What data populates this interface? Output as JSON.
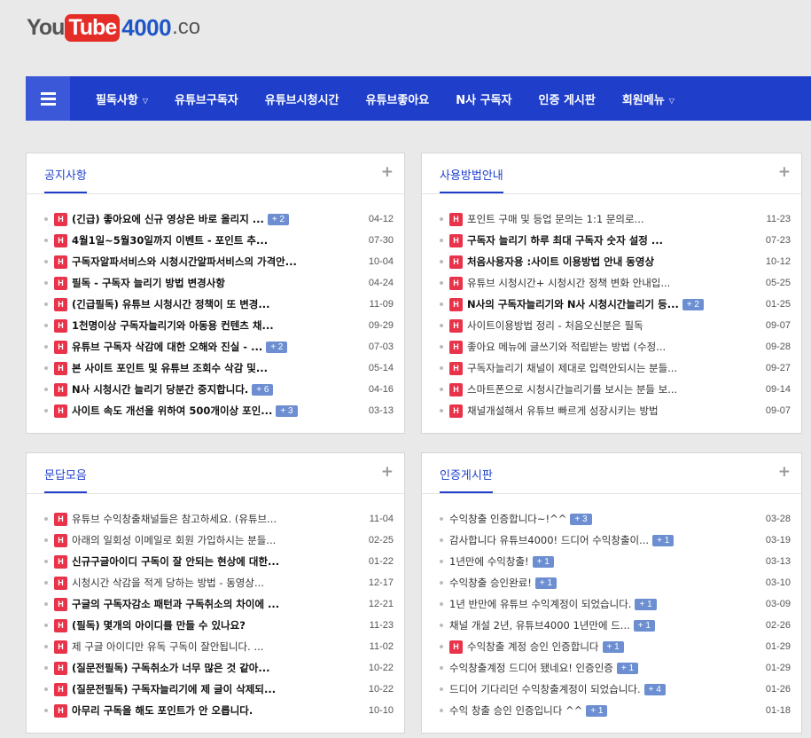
{
  "logo": {
    "you": "You",
    "tube": "Tube",
    "num": "4000",
    "co": ".co"
  },
  "nav": {
    "items": [
      {
        "label": "필독사항",
        "caret": true
      },
      {
        "label": "유튜브구독자",
        "caret": false
      },
      {
        "label": "유튜브시청시간",
        "caret": false
      },
      {
        "label": "유튜브좋아요",
        "caret": false
      },
      {
        "label": "N사 구독자",
        "caret": false
      },
      {
        "label": "인증 게시판",
        "caret": false
      },
      {
        "label": "회원메뉴",
        "caret": true
      }
    ]
  },
  "panels": [
    {
      "title": "공지사항",
      "items": [
        {
          "h": true,
          "text": "(긴급) 좋아요에 신규 영상은 바로 올리지 ...",
          "count": "+ 2",
          "date": "04-12",
          "bold": true
        },
        {
          "h": true,
          "text": "4월1일~5월30일까지 이벤트 - 포인트 추...",
          "count": "",
          "date": "07-30",
          "bold": true
        },
        {
          "h": true,
          "text": "구독자알파서비스와 시청시간알파서비스의 가격안...",
          "count": "",
          "date": "10-04",
          "bold": true
        },
        {
          "h": true,
          "text": "필독 - 구독자 늘리기 방법 변경사항",
          "count": "",
          "date": "04-24",
          "bold": true
        },
        {
          "h": true,
          "text": "(긴급필독) 유튜브 시청시간 정책이 또 변경...",
          "count": "",
          "date": "11-09",
          "bold": true
        },
        {
          "h": true,
          "text": "1천명이상 구독자늘리기와 아동용 컨텐츠 채...",
          "count": "",
          "date": "09-29",
          "bold": true
        },
        {
          "h": true,
          "text": "유튜브 구독자 삭감에 대한 오해와 진실 - ...",
          "count": "+ 2",
          "date": "07-03",
          "bold": true
        },
        {
          "h": true,
          "text": "본 사이트 포인트 및 유튜브 조회수 삭감 및...",
          "count": "",
          "date": "05-14",
          "bold": true
        },
        {
          "h": true,
          "text": "N사 시청시간 늘리기 당분간 중지합니다.",
          "count": "+ 6",
          "date": "04-16",
          "bold": true
        },
        {
          "h": true,
          "text": "사이트 속도 개선을 위하여 500개이상 포인...",
          "count": "+ 3",
          "date": "03-13",
          "bold": true
        }
      ]
    },
    {
      "title": "사용방법안내",
      "items": [
        {
          "h": true,
          "text": "포인트 구매 및 등업 문의는 1:1 문의로...",
          "count": "",
          "date": "11-23",
          "bold": false
        },
        {
          "h": true,
          "text": "구독자 늘리기 하루 최대 구독자 숫자 설정 ...",
          "count": "",
          "date": "07-23",
          "bold": true
        },
        {
          "h": true,
          "text": "처음사용자용 :사이트 이용방법 안내 동영상",
          "count": "",
          "date": "10-12",
          "bold": true
        },
        {
          "h": true,
          "text": "유튜브 시청시간+ 시청시간 정책 변화 안내입...",
          "count": "",
          "date": "05-25",
          "bold": false
        },
        {
          "h": true,
          "text": "N사의 구독자늘리기와 N사 시청시간늘리기 등...",
          "count": "+ 2",
          "date": "01-25",
          "bold": true
        },
        {
          "h": true,
          "text": "사이트이용방법 정리 - 처음오신분은 필독",
          "count": "",
          "date": "09-07",
          "bold": false
        },
        {
          "h": true,
          "text": "좋아요 메뉴에 글쓰기와 적립받는 방법 (수정...",
          "count": "",
          "date": "09-28",
          "bold": false
        },
        {
          "h": true,
          "text": "구독자늘리기 채널이 제대로 입력안되시는 분들...",
          "count": "",
          "date": "09-27",
          "bold": false
        },
        {
          "h": true,
          "text": "스마트폰으로 시청시간늘리기를 보시는 분들 보...",
          "count": "",
          "date": "09-14",
          "bold": false
        },
        {
          "h": true,
          "text": "채널개설해서 유튜브 빠르게 성장시키는 방법",
          "count": "",
          "date": "09-07",
          "bold": false
        }
      ]
    },
    {
      "title": "문답모음",
      "items": [
        {
          "h": true,
          "text": "유튜브 수익창출채널들은 참고하세요. (유튜브...",
          "count": "",
          "date": "11-04",
          "bold": false
        },
        {
          "h": true,
          "text": "아래의 일회성 이메일로 회원 가입하시는 분들...",
          "count": "",
          "date": "02-25",
          "bold": false
        },
        {
          "h": true,
          "text": "신규구글아이디 구독이 잘 안되는 현상에 대한...",
          "count": "",
          "date": "01-22",
          "bold": true
        },
        {
          "h": true,
          "text": "시청시간 삭감을 적게 당하는 방법 - 동영상...",
          "count": "",
          "date": "12-17",
          "bold": false
        },
        {
          "h": true,
          "text": "구글의 구독자감소 패턴과 구독취소의 차이에 ...",
          "count": "",
          "date": "12-21",
          "bold": true
        },
        {
          "h": true,
          "text": "(필독) 몇개의 아이디를 만들 수 있나요?",
          "count": "",
          "date": "11-23",
          "bold": true
        },
        {
          "h": true,
          "text": "제 구글 아이디만 유독 구독이 잘안됩니다. ...",
          "count": "",
          "date": "11-02",
          "bold": false
        },
        {
          "h": true,
          "text": "(질문전필독) 구독취소가 너무 많은 것 같아...",
          "count": "",
          "date": "10-22",
          "bold": true
        },
        {
          "h": true,
          "text": "(질문전필독) 구독자늘리기에 제 글이 삭제되...",
          "count": "",
          "date": "10-22",
          "bold": true
        },
        {
          "h": true,
          "text": "아무리 구독을 해도 포인트가 안 오릅니다.",
          "count": "",
          "date": "10-10",
          "bold": true
        }
      ]
    },
    {
      "title": "인증게시판",
      "items": [
        {
          "h": false,
          "text": "수익창출 인증합니다~!^^",
          "count": "+ 3",
          "date": "03-28",
          "bold": false
        },
        {
          "h": false,
          "text": "감사합니다 유튜브4000! 드디어 수익창출이...",
          "count": "+ 1",
          "date": "03-19",
          "bold": false
        },
        {
          "h": false,
          "text": "1년만에 수익창출!",
          "count": "+ 1",
          "date": "03-13",
          "bold": false
        },
        {
          "h": false,
          "text": "수익창출 승인완료!",
          "count": "+ 1",
          "date": "03-10",
          "bold": false
        },
        {
          "h": false,
          "text": "1년 반만에 유튜브 수익계정이 되었습니다.",
          "count": "+ 1",
          "date": "03-09",
          "bold": false
        },
        {
          "h": false,
          "text": "채널 개설 2년, 유튜브4000 1년만에 드...",
          "count": "+ 1",
          "date": "02-26",
          "bold": false
        },
        {
          "h": true,
          "text": "수익창출 계정 승인 인증합니다",
          "count": "+ 1",
          "date": "01-29",
          "bold": false
        },
        {
          "h": false,
          "text": "수익창출계정 드디어 됐네요! 인증인증",
          "count": "+ 1",
          "date": "01-29",
          "bold": false
        },
        {
          "h": false,
          "text": "드디어 기다리던 수익창출계정이 되었습니다.",
          "count": "+ 4",
          "date": "01-26",
          "bold": false
        },
        {
          "h": false,
          "text": "수익 창출 승인 인증입니다 ^^",
          "count": "+ 1",
          "date": "01-18",
          "bold": false
        }
      ]
    }
  ]
}
